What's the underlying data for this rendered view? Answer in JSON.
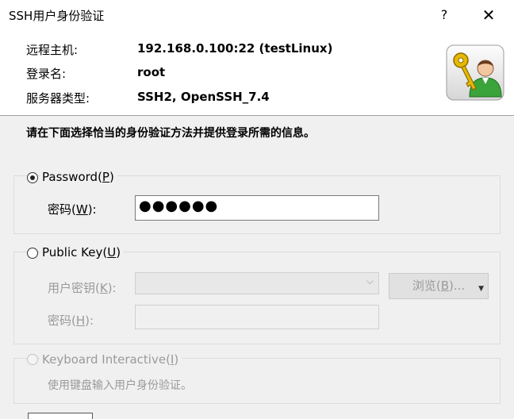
{
  "window": {
    "title": "SSH用户身份验证",
    "help_label": "?",
    "close_label": "✕"
  },
  "info": {
    "host_label": "远程主机:",
    "host_value": "192.168.0.100:22 (testLinux)",
    "login_label": "登录名:",
    "login_value": "root",
    "server_type_label": "服务器类型:",
    "server_type_value": "SSH2, OpenSSH_7.4",
    "icon": "key-user-icon"
  },
  "instruction": "请在下面选择恰当的身份验证方法并提供登录所需的信息。",
  "password_method": {
    "label_pre": "Password(",
    "label_key": "P",
    "label_post": ")",
    "selected": true,
    "field_label_pre": "密码(",
    "field_label_key": "W",
    "field_label_post": "):",
    "field_value": "●●●●●●"
  },
  "public_key_method": {
    "label_pre": "Public Key(",
    "label_key": "U",
    "label_post": ")",
    "selected": false,
    "user_key_label_pre": "用户密钥(",
    "user_key_label_key": "K",
    "user_key_label_post": "):",
    "browse_pre": "浏览(",
    "browse_key": "B",
    "browse_post": ")...",
    "passphrase_label_pre": "密码(",
    "passphrase_label_key": "H",
    "passphrase_label_post": "):"
  },
  "keyboard_method": {
    "label_pre": "Keyboard Interactive(",
    "label_key": "I",
    "label_post": ")",
    "selected": false,
    "description": "使用键盘输入用户身份验证。"
  },
  "colors": {
    "window_bg": "#f0f0f0",
    "info_bg": "#ffffff",
    "disabled_text": "#9a9a9a",
    "icon_green": "#3aa33a",
    "icon_key": "#e6b800"
  }
}
